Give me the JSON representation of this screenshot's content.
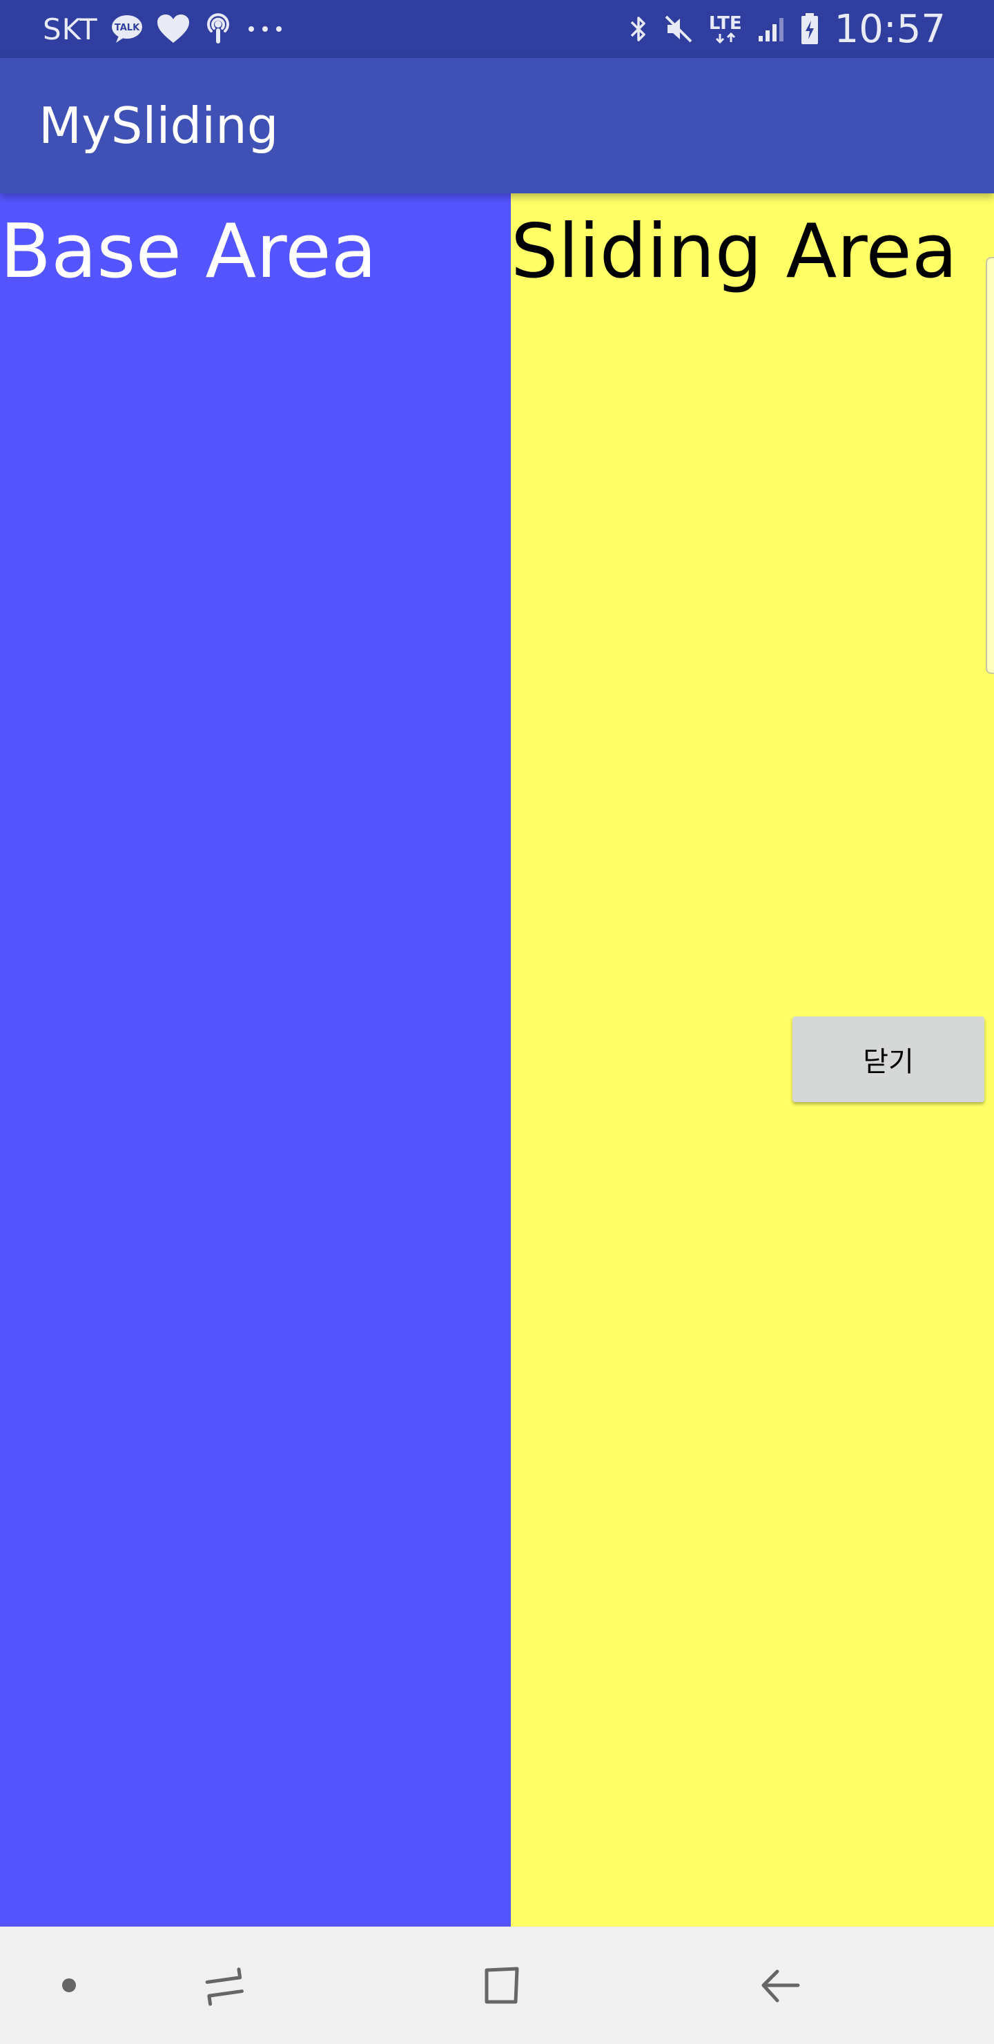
{
  "status_bar": {
    "carrier": "SKT",
    "talk_badge": "TALK",
    "network": "LTE",
    "time": "10:57",
    "icons_left": [
      "kakaotalk-icon",
      "heart-icon",
      "podcast-icon",
      "more-dots-icon"
    ],
    "icons_right": [
      "bluetooth-icon",
      "mute-icon",
      "lte-icon",
      "signal-icon",
      "battery-charging-icon"
    ]
  },
  "app_bar": {
    "title": "MySliding"
  },
  "base_area": {
    "title": "Base Area",
    "color": "#5555ff"
  },
  "sliding_area": {
    "title": "Sliding Area",
    "color": "#ffff66",
    "close_button_label": "닫기"
  },
  "nav_bar": {
    "icons": [
      "dot-icon",
      "recent-apps-icon",
      "home-icon",
      "back-icon"
    ]
  },
  "colors": {
    "status_bar": "#303f9f",
    "app_bar": "#3f51b5",
    "nav_bar": "#f0f0f0"
  }
}
